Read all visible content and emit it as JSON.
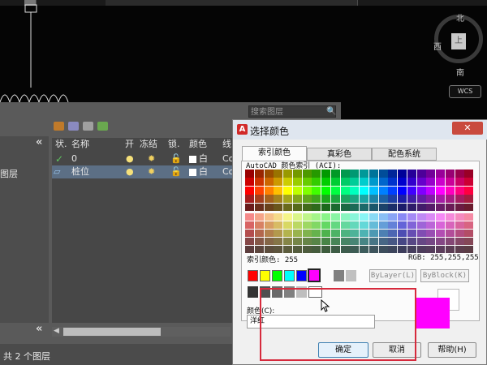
{
  "viewcube": {
    "north": "北",
    "south": "南",
    "west": "西",
    "face": "上",
    "wcs": "WCS"
  },
  "layer_manager": {
    "search_placeholder": "搜索图层",
    "tree_label": "图层",
    "collapse_glyph": "«",
    "columns": [
      "状.",
      "名称",
      "开",
      "冻结",
      "锁.",
      "颜色",
      "线"
    ],
    "rows": [
      {
        "name": "0",
        "color": "白",
        "linetype": "Co"
      },
      {
        "name": "桩位",
        "color": "白",
        "linetype": "Co"
      }
    ],
    "status": "共 2 个图层"
  },
  "dialog": {
    "title": "选择颜色",
    "close_glyph": "✕",
    "tabs": [
      "索引颜色",
      "真彩色",
      "配色系统"
    ],
    "aci_label": "AutoCAD 颜色索引 (ACI):",
    "index_label": "索引颜色: 255",
    "rgb_label": "RGB: 255,255,255",
    "bylayer": "ByLayer(L)",
    "byblock": "ByBlock(K)",
    "color_label": "颜色(C):",
    "color_value": "洋红",
    "ok": "确定",
    "cancel": "取消",
    "help": "帮助(H)"
  },
  "colors": {
    "standard": [
      "#ff0000",
      "#ffff00",
      "#00ff00",
      "#00ffff",
      "#0000ff",
      "#ff00ff",
      "#ffffff",
      "#808080",
      "#c0c0c0"
    ],
    "grays": [
      "#333333",
      "#505050",
      "#696969",
      "#808080",
      "#bebebe",
      "#ffffff"
    ],
    "selected": "#ff00ff",
    "highlight_box": "#d62a3c"
  }
}
